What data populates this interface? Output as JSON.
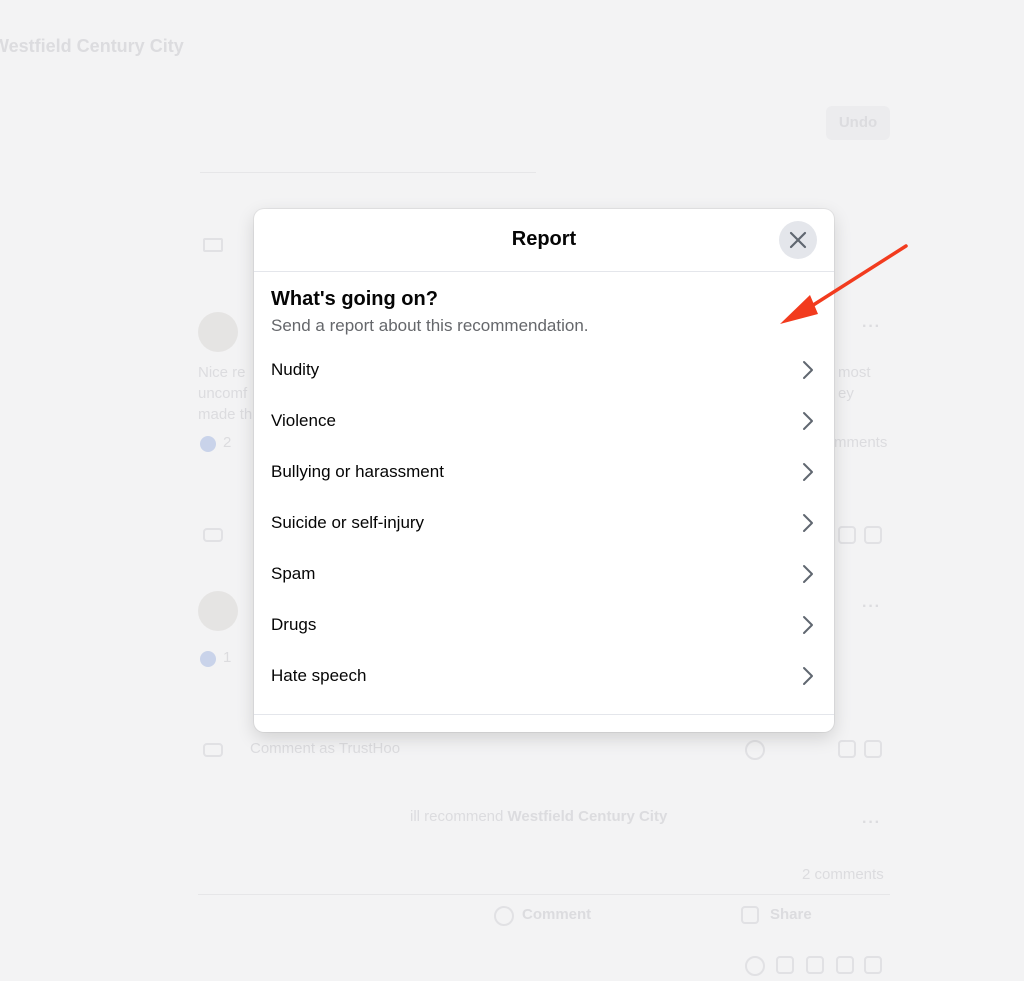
{
  "background": {
    "page_title": "Westfield Century City",
    "undo_label": "Undo",
    "comment_placeholder": "Comment as TrustHoo",
    "recommend_prefix": "ill recommend",
    "recommend_place": "Westfield Century City",
    "comments_count": "2 comments",
    "comment_label": "Comment",
    "share_label": "Share",
    "snippet_left_1": "Nice re",
    "snippet_left_2": "uncomf",
    "snippet_left_3": "made th",
    "snippet_right_1": "most",
    "snippet_right_2": "ey",
    "snippet_right_3": "mments",
    "like_count_1": "2",
    "like_count_2": "1"
  },
  "modal": {
    "title": "Report",
    "question": "What's going on?",
    "subtitle": "Send a report about this recommendation.",
    "options": [
      {
        "label": "Nudity"
      },
      {
        "label": "Violence"
      },
      {
        "label": "Bullying or harassment"
      },
      {
        "label": "Suicide or self-injury"
      },
      {
        "label": "Spam"
      },
      {
        "label": "Drugs"
      },
      {
        "label": "Hate speech"
      }
    ]
  },
  "colors": {
    "annotation_arrow": "#f23b1e",
    "overlay_background": "#f3f3f4",
    "close_button_bg": "#e4e6eb"
  },
  "icons": {
    "close": "close-icon",
    "chevron": "chevron-right-icon",
    "annotation": "annotation-arrow-icon"
  }
}
